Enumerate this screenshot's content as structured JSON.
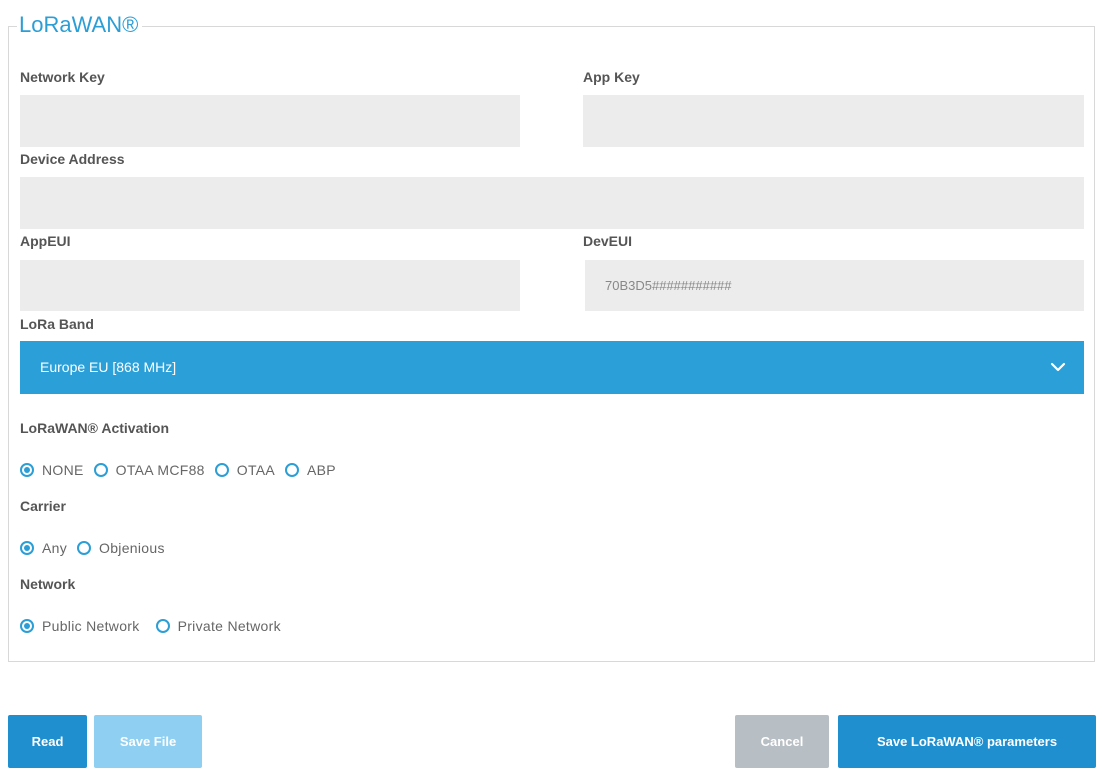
{
  "panel": {
    "legend": "LoRaWAN®"
  },
  "fields": {
    "network_key": {
      "label": "Network Key",
      "value": ""
    },
    "app_key": {
      "label": "App Key",
      "value": ""
    },
    "device_address": {
      "label": "Device Address",
      "value": ""
    },
    "app_eui": {
      "label": "AppEUI",
      "value": ""
    },
    "dev_eui": {
      "label": "DevEUI",
      "value": "70B3D5###########"
    }
  },
  "lora_band": {
    "label": "LoRa Band",
    "selected": "Europe EU [868 MHz]",
    "icon": "chevron-down-icon"
  },
  "activation": {
    "label": "LoRaWAN® Activation",
    "options": [
      {
        "label": "NONE",
        "checked": true
      },
      {
        "label": "OTAA MCF88",
        "checked": false
      },
      {
        "label": "OTAA",
        "checked": false
      },
      {
        "label": "ABP",
        "checked": false
      }
    ]
  },
  "carrier": {
    "label": "Carrier",
    "options": [
      {
        "label": "Any",
        "checked": true
      },
      {
        "label": "Objenious",
        "checked": false
      }
    ]
  },
  "network": {
    "label": "Network",
    "options": [
      {
        "label": "Public Network",
        "checked": true
      },
      {
        "label": "Private Network",
        "checked": false
      }
    ]
  },
  "buttons": {
    "read": "Read",
    "save_file": "Save File",
    "cancel": "Cancel",
    "save_params": "Save LoRaWAN® parameters"
  },
  "colors": {
    "accent": "#2a9fd8",
    "button_primary": "#1f8fd0",
    "button_disabled_light": "#8fd0f2",
    "button_cancel": "#b7bec4",
    "input_bg": "#ececec"
  }
}
